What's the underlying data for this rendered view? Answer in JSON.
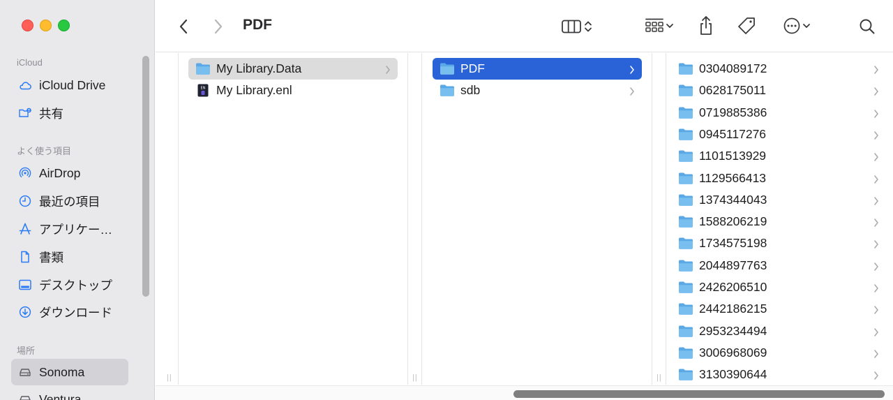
{
  "window": {
    "title": "PDF"
  },
  "sidebar": {
    "sections": [
      {
        "label": "iCloud",
        "items": [
          {
            "label": "iCloud Drive",
            "icon": "cloud-icon"
          },
          {
            "label": "共有",
            "icon": "shared-folder-icon"
          }
        ]
      },
      {
        "label": "よく使う項目",
        "items": [
          {
            "label": "AirDrop",
            "icon": "airdrop-icon"
          },
          {
            "label": "最近の項目",
            "icon": "clock-icon"
          },
          {
            "label": "アプリケー…",
            "icon": "applications-icon"
          },
          {
            "label": "書類",
            "icon": "document-icon"
          },
          {
            "label": "デスクトップ",
            "icon": "desktop-icon"
          },
          {
            "label": "ダウンロード",
            "icon": "download-icon"
          }
        ]
      },
      {
        "label": "場所",
        "items": [
          {
            "label": "Sonoma",
            "icon": "drive-icon",
            "selected": true
          },
          {
            "label": "Ventura",
            "icon": "drive-icon"
          }
        ]
      }
    ]
  },
  "columns": [
    {
      "items": [
        {
          "name": "My Library.Data",
          "kind": "folder",
          "selected": "inactive",
          "has_children": true
        },
        {
          "name": "My Library.enl",
          "kind": "endnote-file"
        }
      ]
    },
    {
      "items": [
        {
          "name": "PDF",
          "kind": "folder",
          "selected": "active",
          "has_children": true
        },
        {
          "name": "sdb",
          "kind": "folder",
          "has_children": true
        }
      ]
    },
    {
      "items": [
        {
          "name": "0304089172",
          "kind": "folder",
          "has_children": true
        },
        {
          "name": "0628175011",
          "kind": "folder",
          "has_children": true
        },
        {
          "name": "0719885386",
          "kind": "folder",
          "has_children": true
        },
        {
          "name": "0945117276",
          "kind": "folder",
          "has_children": true
        },
        {
          "name": "1101513929",
          "kind": "folder",
          "has_children": true
        },
        {
          "name": "1129566413",
          "kind": "folder",
          "has_children": true
        },
        {
          "name": "1374344043",
          "kind": "folder",
          "has_children": true
        },
        {
          "name": "1588206219",
          "kind": "folder",
          "has_children": true
        },
        {
          "name": "1734575198",
          "kind": "folder",
          "has_children": true
        },
        {
          "name": "2044897763",
          "kind": "folder",
          "has_children": true
        },
        {
          "name": "2426206510",
          "kind": "folder",
          "has_children": true
        },
        {
          "name": "2442186215",
          "kind": "folder",
          "has_children": true
        },
        {
          "name": "2953234494",
          "kind": "folder",
          "has_children": true
        },
        {
          "name": "3006968069",
          "kind": "folder",
          "has_children": true
        },
        {
          "name": "3130390644",
          "kind": "folder",
          "has_children": true
        }
      ]
    }
  ],
  "colors": {
    "accent": "#2a62d8",
    "folder": "#5aa9e6",
    "sidebar_icon": "#2a7bf6",
    "sidebar_bg": "#e9e8ea"
  }
}
